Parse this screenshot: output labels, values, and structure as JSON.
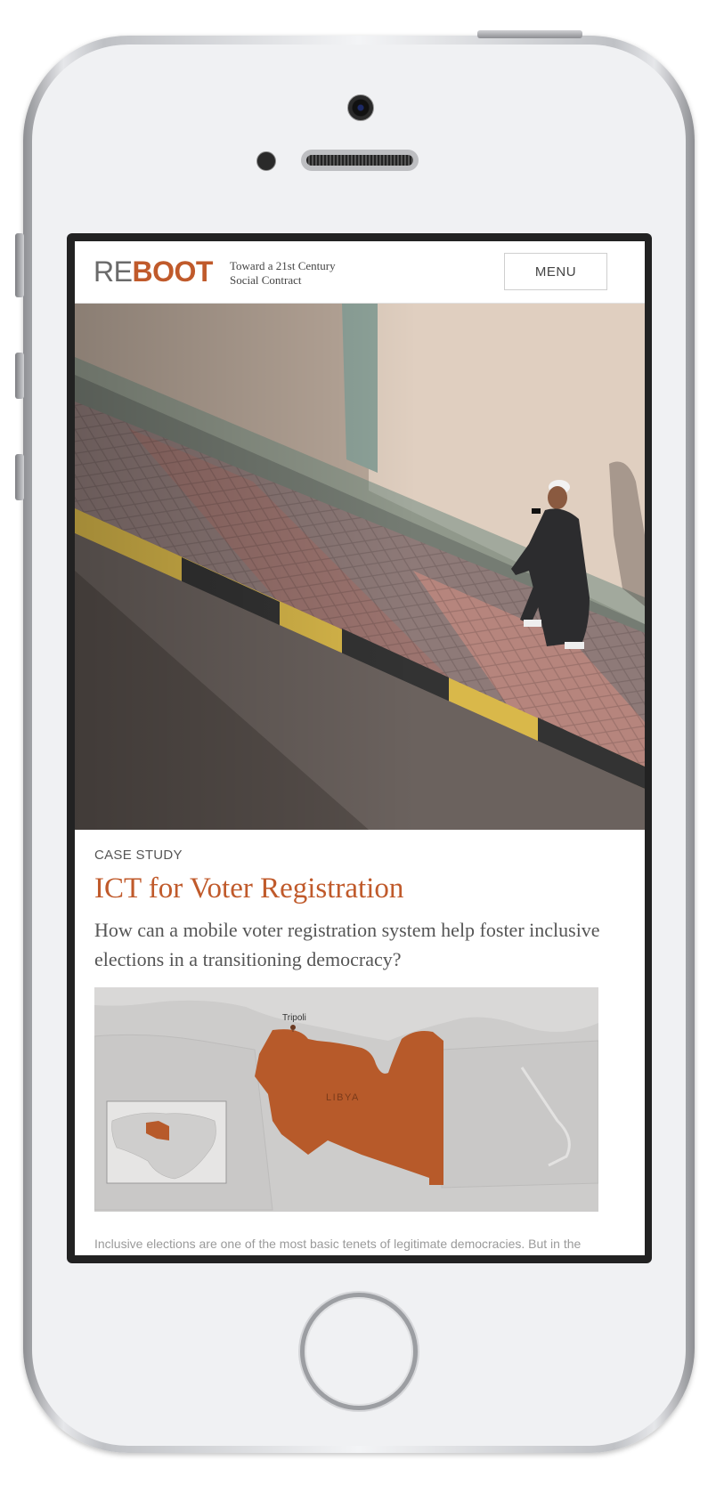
{
  "site": {
    "logo_prefix": "RE",
    "logo_suffix": "BOOT",
    "tagline_line1": "Toward a 21st Century",
    "tagline_line2": "Social Contract",
    "menu_label": "MENU"
  },
  "hero": {
    "image_description": "man in robe walking on sidewalk"
  },
  "article": {
    "eyebrow": "CASE STUDY",
    "title": "ICT for Voter Registration",
    "subtitle": "How can a mobile voter registration system help foster inclusive elections in a transitioning democracy?",
    "body_preview": "Inclusive elections are one of the most basic tenets of legitimate democracies. But in the"
  },
  "map": {
    "city_label": "Tripoli",
    "country_label": "LIBYA"
  },
  "colors": {
    "brand": "#c05a2b",
    "text": "#555555",
    "map_bg": "#cdcccb"
  }
}
